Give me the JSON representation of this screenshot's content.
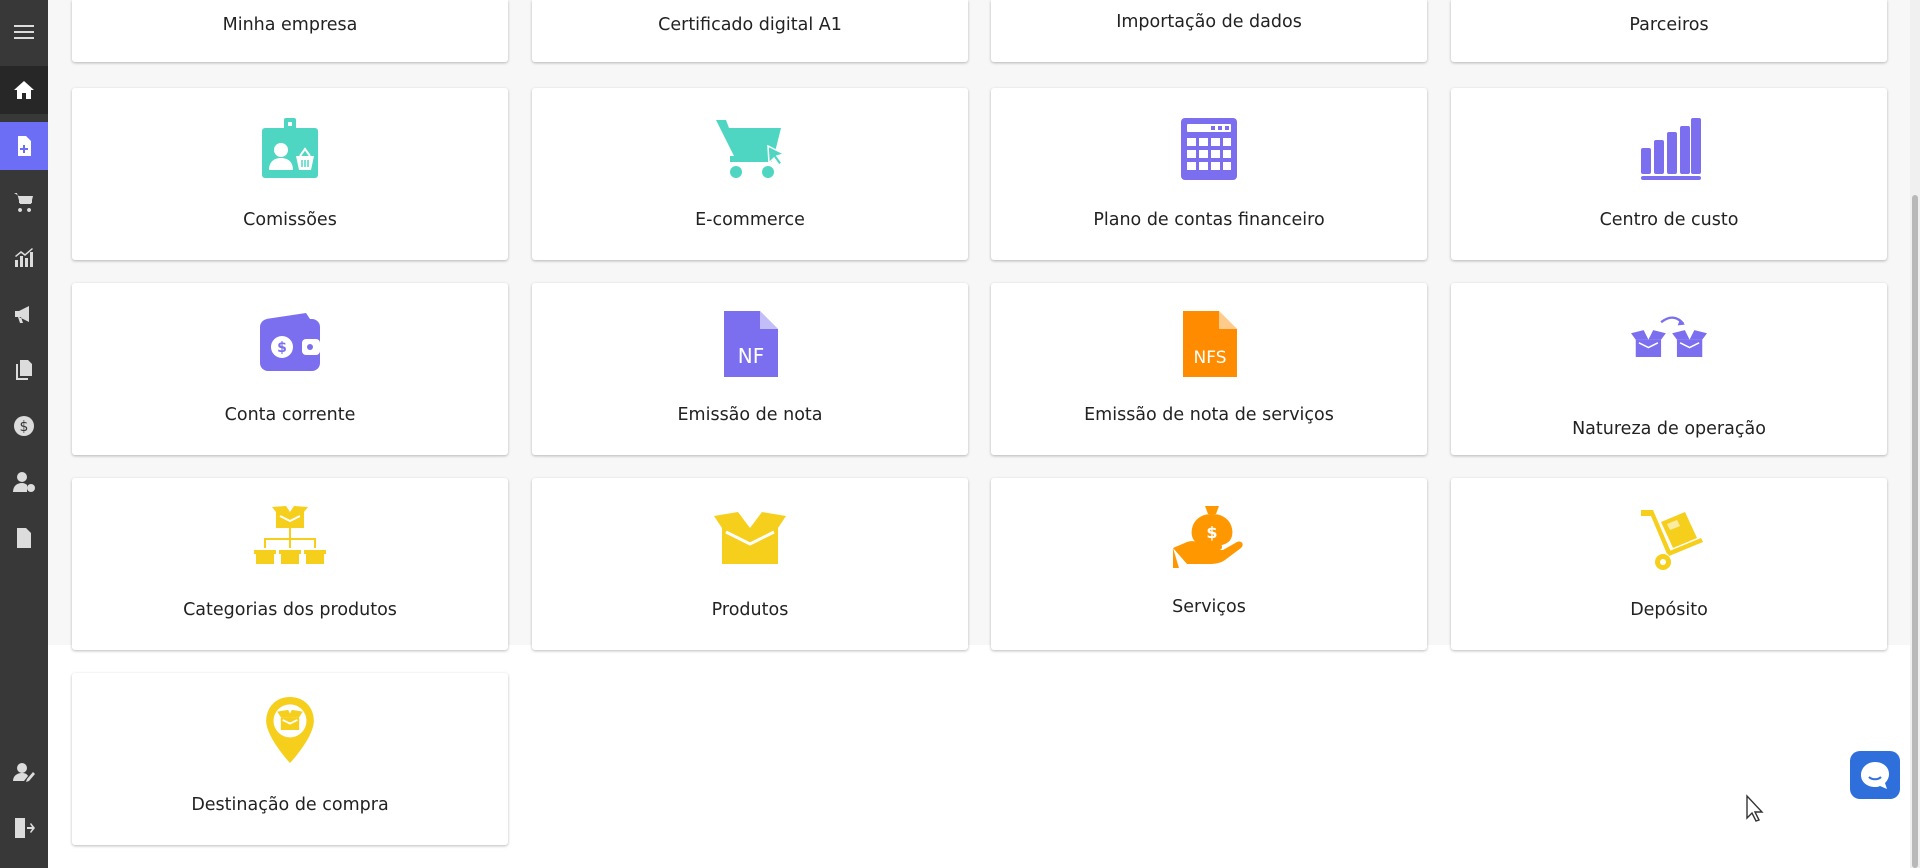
{
  "sidebar": {
    "items": [
      {
        "name": "menu-icon"
      },
      {
        "name": "home-icon"
      },
      {
        "name": "document-add-icon"
      },
      {
        "name": "cart-icon"
      },
      {
        "name": "chart-icon"
      },
      {
        "name": "megaphone-icon"
      },
      {
        "name": "documents-icon"
      },
      {
        "name": "dollar-icon"
      },
      {
        "name": "user-settings-icon"
      },
      {
        "name": "file-icon"
      },
      {
        "name": "support-user-icon"
      },
      {
        "name": "logout-icon"
      }
    ]
  },
  "cards_top": [
    {
      "label": "Minha empresa"
    },
    {
      "label": "Certificado digital A1"
    },
    {
      "label": "Importação de dados"
    },
    {
      "label": "Parceiros"
    }
  ],
  "cards": [
    {
      "label": "Comissões",
      "icon": "commission-badge-icon",
      "color": "#4fd6c2"
    },
    {
      "label": "E-commerce",
      "icon": "shopping-cart-icon",
      "color": "#4fd6c2"
    },
    {
      "label": "Plano de contas financeiro",
      "icon": "calculator-icon",
      "color": "#7b6ff0"
    },
    {
      "label": "Centro de custo",
      "icon": "bar-chart-icon",
      "color": "#7b6ff0"
    },
    {
      "label": "Conta corrente",
      "icon": "wallet-icon",
      "color": "#7b6ff0"
    },
    {
      "label": "Emissão de nota",
      "icon": "nf-document-icon",
      "color": "#7b6ff0",
      "badge": "NF"
    },
    {
      "label": "Emissão de nota de serviços",
      "icon": "nfs-document-icon",
      "color": "#ff8c00",
      "badge": "NFS"
    },
    {
      "label": "Natureza de operação",
      "icon": "boxes-transfer-icon",
      "color": "#7b6ff0"
    },
    {
      "label": "Categorias dos produtos",
      "icon": "box-hierarchy-icon",
      "color": "#f6cf1d"
    },
    {
      "label": "Produtos",
      "icon": "open-box-icon",
      "color": "#f6cf1d"
    },
    {
      "label": "Serviços",
      "icon": "money-bag-hand-icon",
      "color": "#ff9800"
    },
    {
      "label": "Depósito",
      "icon": "hand-truck-icon",
      "color": "#f6cf1d"
    },
    {
      "label": "Destinação de compra",
      "icon": "location-box-icon",
      "color": "#f6cf1d"
    }
  ],
  "colors": {
    "sidebar_bg": "#383838",
    "sidebar_active": "#6c6ff5",
    "chat_button": "#2f6fdb"
  }
}
